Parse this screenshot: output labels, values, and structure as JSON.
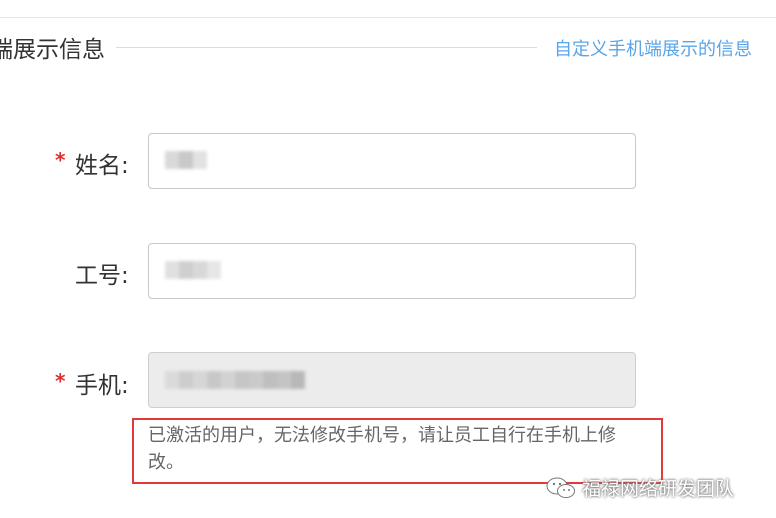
{
  "section": {
    "title": "端展示信息",
    "link_label": "自定义手机端展示的信息"
  },
  "fields": {
    "name": {
      "label": "姓名:",
      "required": true
    },
    "employee_id": {
      "label": "工号:",
      "required": false
    },
    "mobile": {
      "label": "手机:",
      "required": true,
      "disabled": true
    }
  },
  "notice": "已激活的用户，无法修改手机号，请让员工自行在手机上修改。",
  "watermark": "福禄网络研发团队",
  "colors": {
    "required_star": "#e02d2d",
    "link": "#5aa5e8",
    "notice_border": "#e23a3a"
  }
}
